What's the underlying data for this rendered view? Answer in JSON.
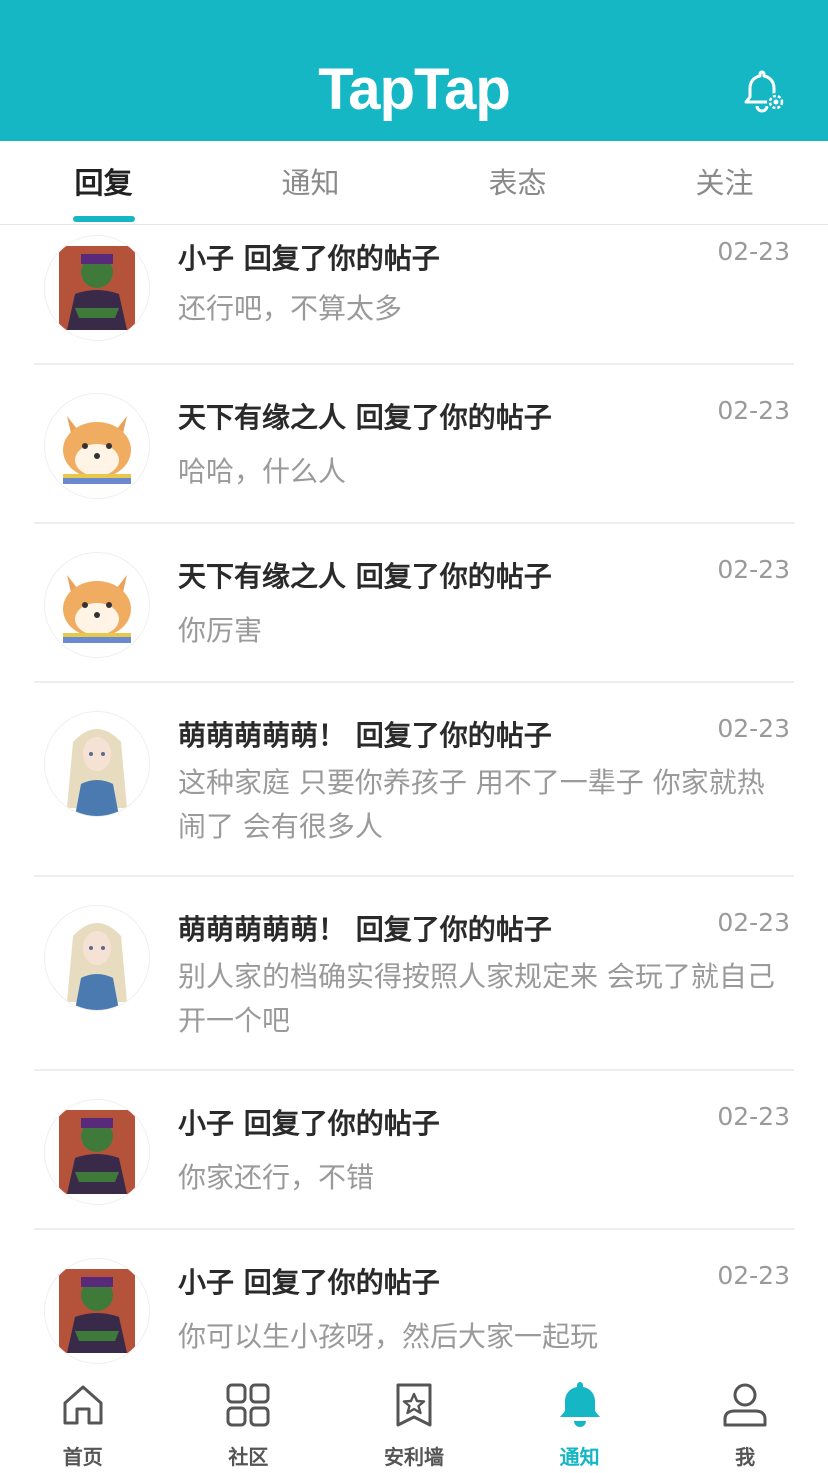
{
  "header": {
    "logo": "TapTap"
  },
  "tabs": [
    {
      "label": "回复",
      "active": true
    },
    {
      "label": "通知",
      "active": false
    },
    {
      "label": "表态",
      "active": false
    },
    {
      "label": "关注",
      "active": false
    }
  ],
  "items": [
    {
      "avatar": "green-ninja-avatar",
      "title": "小子 回复了你的帖子",
      "date": "02-23",
      "message": "还行吧，不算太多"
    },
    {
      "avatar": "shiba-avatar",
      "title": "天下有缘之人 回复了你的帖子",
      "date": "02-23",
      "message": "哈哈，什么人"
    },
    {
      "avatar": "shiba-avatar",
      "title": "天下有缘之人 回复了你的帖子",
      "date": "02-23",
      "message": "你厉害"
    },
    {
      "avatar": "blonde-girl-avatar",
      "title": "萌萌萌萌萌！ 回复了你的帖子",
      "date": "02-23",
      "message": "这种家庭 只要你养孩子  用不了一辈子 你家就热闹了 会有很多人"
    },
    {
      "avatar": "blonde-girl-avatar",
      "title": "萌萌萌萌萌！ 回复了你的帖子",
      "date": "02-23",
      "message": "别人家的档确实得按照人家规定来 会玩了就自己开一个吧"
    },
    {
      "avatar": "green-ninja-avatar",
      "title": "小子 回复了你的帖子",
      "date": "02-23",
      "message": "你家还行，不错"
    },
    {
      "avatar": "green-ninja-avatar",
      "title": "小子 回复了你的帖子",
      "date": "02-23",
      "message": "你可以生小孩呀，然后大家一起玩"
    }
  ],
  "bottom_nav": [
    {
      "label": "首页",
      "icon": "home-icon",
      "active": false
    },
    {
      "label": "社区",
      "icon": "grid-icon",
      "active": false
    },
    {
      "label": "安利墙",
      "icon": "star-bookmark-icon",
      "active": false
    },
    {
      "label": "通知",
      "icon": "bell-icon",
      "active": true
    },
    {
      "label": "我",
      "icon": "user-icon",
      "active": false
    }
  ],
  "colors": {
    "accent": "#15b7c5",
    "date_gray": "#9a9a9a",
    "divider": "#eeeeee"
  }
}
